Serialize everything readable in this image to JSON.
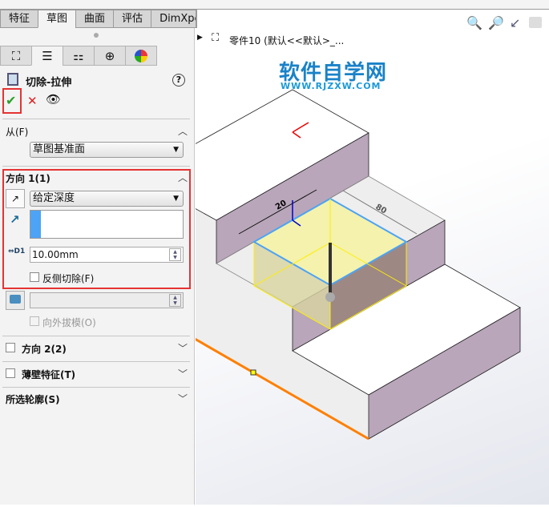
{
  "tabs": [
    "特征",
    "草图",
    "曲面",
    "评估",
    "DimXpert"
  ],
  "active_tab": "草图",
  "property_tabs": [
    "feature-manager",
    "property-manager",
    "configuration-manager",
    "dimxpert-manager",
    "display-manager"
  ],
  "feature": {
    "title": "切除-拉伸",
    "help": "?",
    "ok": "✔",
    "cancel": "✕",
    "preview": "👁"
  },
  "from": {
    "label": "从(F)",
    "value": "草图基准面"
  },
  "direction1": {
    "label": "方向 1(1)",
    "end_condition": "给定深度",
    "depth": "10.00mm",
    "depth_icon_label": "D1",
    "flip_side_label": "反侧切除(F)",
    "draft_outward_label": "向外拔模(O)"
  },
  "direction2": {
    "label": "方向 2(2)"
  },
  "thin_feature": {
    "label": "薄壁特征(T)"
  },
  "selected_contours": {
    "label": "所选轮廓(S)"
  },
  "tree": {
    "part": "零件10  (默认<<默认>_..."
  },
  "watermark": {
    "title": "软件自学网",
    "url": "WWW.RJZXW.COM"
  },
  "dimensions": [
    "20",
    "80"
  ],
  "colors": {
    "accent_red": "#e53333",
    "face_purple": "#b9a6ba",
    "preview_yellow": "#f4f2a0",
    "edge_orange": "#ff7f00",
    "sketch_blue": "#4da3f5"
  }
}
